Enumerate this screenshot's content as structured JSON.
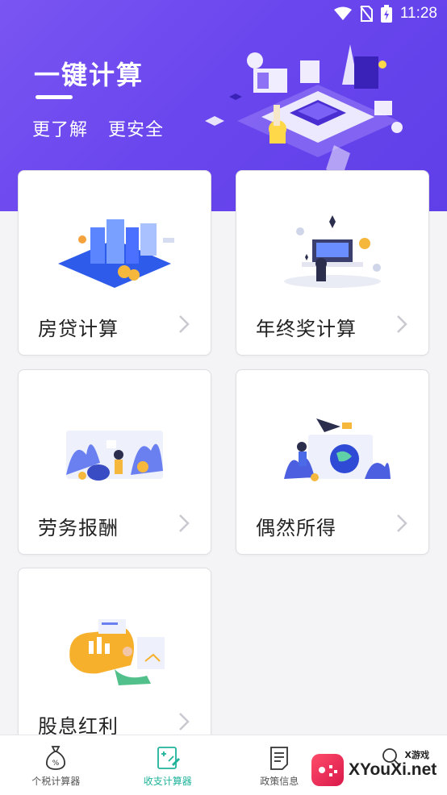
{
  "status_bar": {
    "time": "11:28"
  },
  "header": {
    "title": "一键计算",
    "tags": [
      "更了解",
      "更安全"
    ]
  },
  "cards": [
    {
      "label": "房贷计算"
    },
    {
      "label": "年终奖计算"
    },
    {
      "label": "劳务报酬"
    },
    {
      "label": "偶然所得"
    },
    {
      "label": "股息红利"
    }
  ],
  "bottom_nav": {
    "items": [
      {
        "label": "个税计算器",
        "icon": "money-bag-icon",
        "active": false
      },
      {
        "label": "收支计算器",
        "icon": "calculator-icon",
        "active": true
      },
      {
        "label": "政策信息",
        "icon": "document-icon",
        "active": false
      },
      {
        "label": "",
        "icon": "search-icon",
        "active": false
      }
    ]
  },
  "watermark": {
    "text": "XYouXi.net",
    "sub": "X游戏"
  },
  "colors": {
    "header": "#6a46ee",
    "active_tab": "#1fb39a"
  }
}
